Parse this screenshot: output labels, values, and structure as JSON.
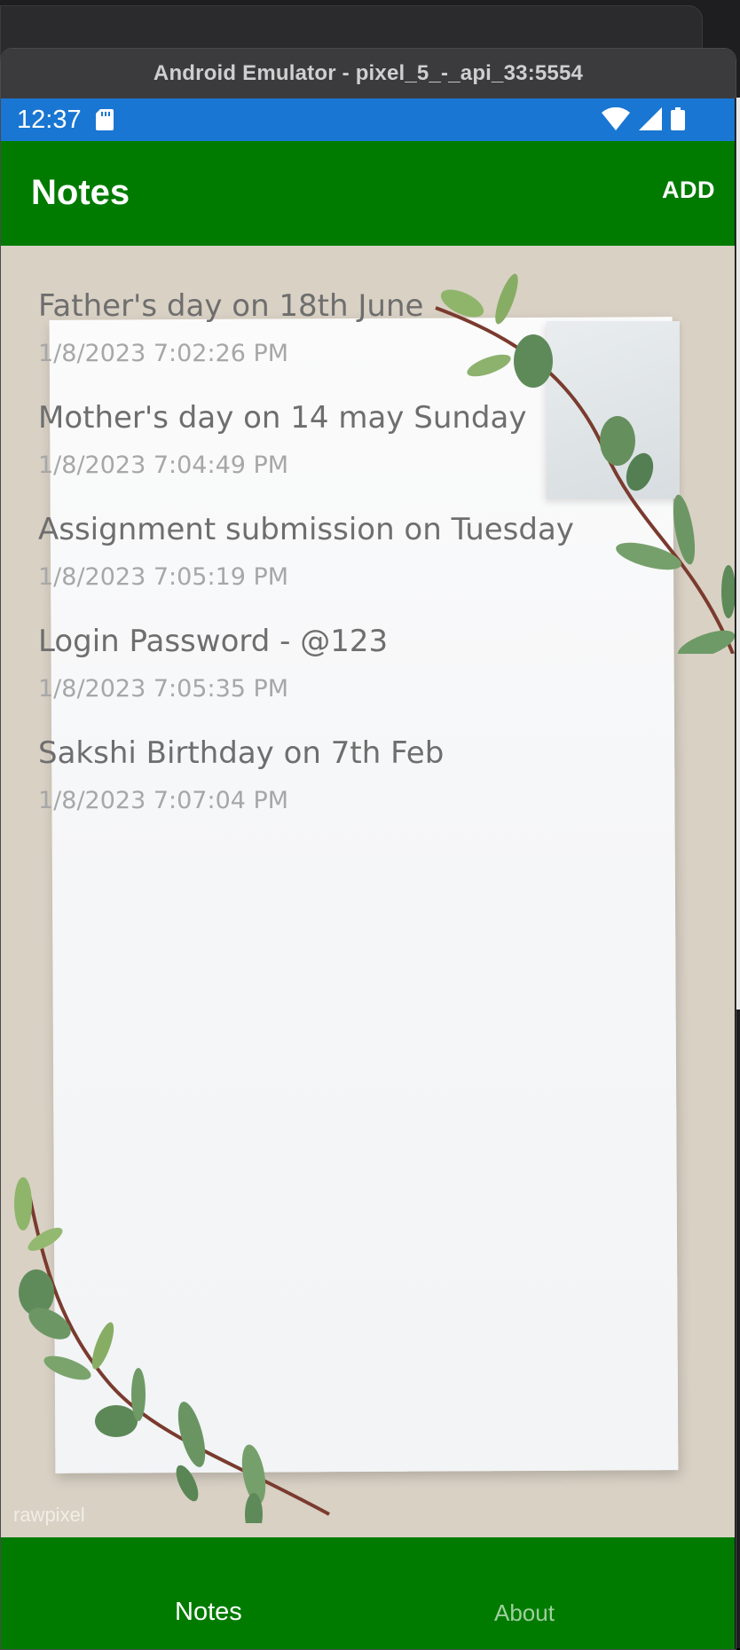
{
  "window": {
    "title": "Android Emulator - pixel_5_-_api_33:5554"
  },
  "status_bar": {
    "time": "12:37",
    "icons": [
      "sd-card-icon",
      "wifi-icon",
      "signal-icon",
      "battery-icon"
    ],
    "color": "#1976d2"
  },
  "app_bar": {
    "title": "Notes",
    "add_label": "ADD",
    "color": "#007b00"
  },
  "notes": [
    {
      "text": "Father's day on 18th June",
      "date": "1/8/2023 7:02:26 PM"
    },
    {
      "text": "Mother's day on 14 may Sunday",
      "date": "1/8/2023 7:04:49 PM"
    },
    {
      "text": "Assignment submission on Tuesday",
      "date": "1/8/2023 7:05:19 PM"
    },
    {
      "text": "Login Password - @123",
      "date": "1/8/2023 7:05:35 PM"
    },
    {
      "text": "Sakshi Birthday on 7th Feb",
      "date": "1/8/2023 7:07:04 PM"
    }
  ],
  "background": {
    "watermark": "rawpixel"
  },
  "tab_bar": {
    "tabs": [
      {
        "label": "Notes",
        "active": true
      },
      {
        "label": "About",
        "active": false
      }
    ],
    "color": "#007b00"
  }
}
